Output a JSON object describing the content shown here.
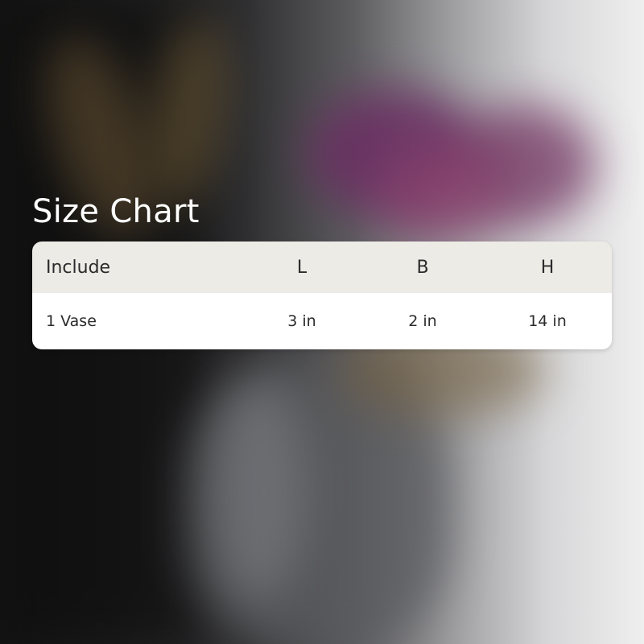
{
  "size_chart": {
    "title": "Size Chart",
    "headers": {
      "include": "Include",
      "length": "L",
      "breadth": "B",
      "height": "H"
    },
    "rows": [
      {
        "include": "1 Vase",
        "length": "3 in",
        "breadth": "2 in",
        "height": "14 in"
      }
    ]
  },
  "colors": {
    "header_background": "#ECEBE6",
    "row_background": "#FFFFFF",
    "text": "#2B2B2B",
    "title_text": "#FFFFFF"
  }
}
